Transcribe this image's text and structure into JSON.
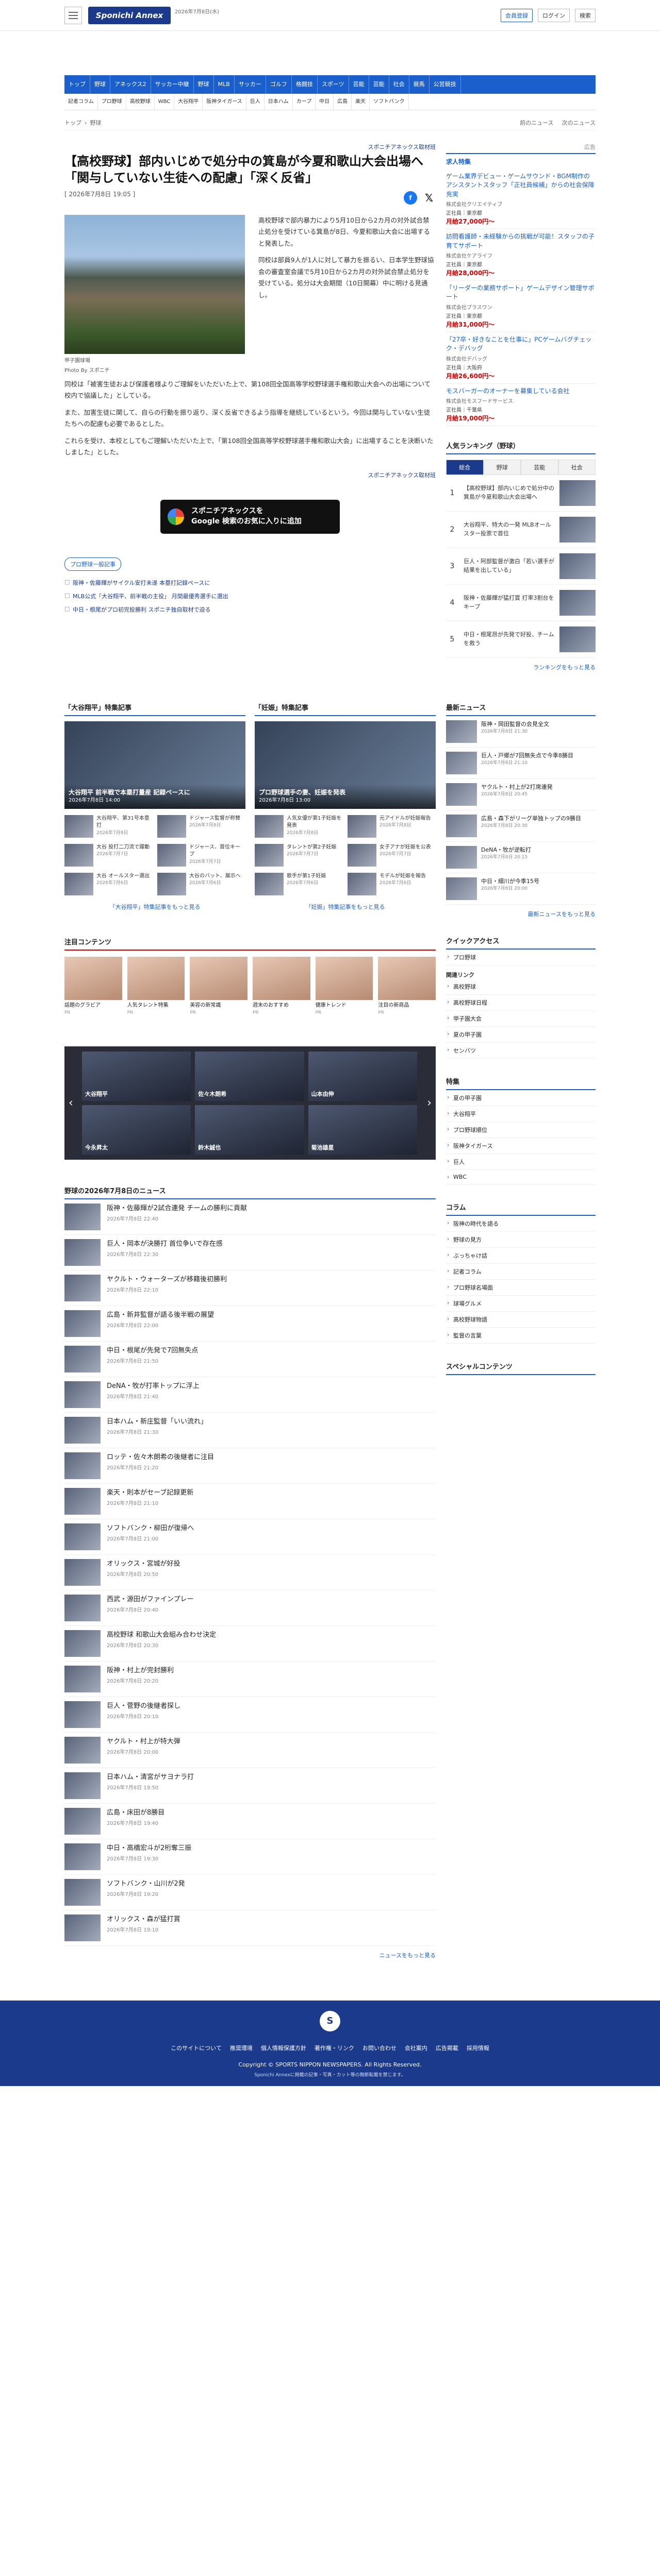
{
  "header": {
    "logo": "Sponichi Annex",
    "date": "2026年7月8日(水)",
    "login_btn": "会員登録",
    "login": "ログイン",
    "search": "検索"
  },
  "nav1": [
    "トップ",
    "野球",
    "アネックス2",
    "サッカー中継",
    "野球",
    "MLB",
    "サッカー",
    "ゴルフ",
    "格闘技",
    "スポーツ",
    "芸能",
    "芸能",
    "社会",
    "競馬",
    "公営競技"
  ],
  "nav2": [
    "記者コラム",
    "プロ野球",
    "高校野球",
    "WBC",
    "大谷翔平",
    "阪神タイガース",
    "巨人",
    "日本ハム",
    "カープ",
    "中日",
    "広島",
    "楽天",
    "ソフトバンク"
  ],
  "crumbs": {
    "top": "トップ",
    "cat": "野球",
    "prev": "前のニュース",
    "next": "次のニュース"
  },
  "article": {
    "source": "スポニチアネックス取材班",
    "title": "【高校野球】部内いじめで処分中の箕島が今夏和歌山大会出場へ「関与していない生徒への配慮」「深く反省」",
    "date": "[ 2026年7月8日 19:05 ]",
    "photo_cap1": "甲子園球場",
    "photo_cap2": "Photo By スポニチ",
    "p1": "高校野球で部内暴力により5月10日から2カ月の対外試合禁止処分を受けている箕島が8日、今夏和歌山大会に出場すると発表した。",
    "p2": "同校は部員9人が1人に対して暴力を振るい、日本学生野球協会の審査室会議で5月10日から2カ月の対外試合禁止処分を受けている。処分は大会期間（10日開幕）中に明ける見通し。",
    "p3": "同校は「被害生徒および保護者様よりご理解をいただいた上で、第108回全国高等学校野球選手権和歌山大会への出場について校内で協議した」としている。",
    "p4": "また、加害生徒に関して、自らの行動を振り返り、深く反省できるよう指導を継続しているという。今回は関与していない生徒たちへの配慮も必要であるとした。",
    "p5": "これらを受け、本校としてもご理解いただいた上で、「第108回全国高等学校野球選手権和歌山大会」に出場することを決断いたしました」とした。",
    "credit": "スポニチアネックス取材班",
    "gnews": "スポニチアネックスを\nGoogle 検索のお気に入りに追加",
    "tag": "プロ野球一般記事",
    "related": [
      "阪神・佐藤輝がサイクル安打未遂 本塁打記録ペースに",
      "MLB公式「大谷翔平、前半戦の主役」 月間最優秀選手に選出",
      "中日・根尾がプロ初完投勝利 スポニチ独自取材で迫る"
    ]
  },
  "side": {
    "ad_label": "広告",
    "pr_head": "求人特集",
    "pr": [
      {
        "t": "ゲーム業界デビュー・ゲームサウンド・BGM制作のアシスタントスタッフ「正社員候補」からの社会保障充実",
        "s": "株式会社クリエイティブ",
        "m": "正社員｜東京都",
        "y": "月給27,000円〜"
      },
      {
        "t": "訪問看護師・未経験からの挑戦が可能！スタッフの子育てサポート",
        "s": "株式会社ケアライフ",
        "m": "正社員｜東京都",
        "y": "月給28,000円〜"
      },
      {
        "t": "「リーダーの業務サポート」ゲームデザイン管理サポート",
        "s": "株式会社プラスワン",
        "m": "正社員｜東京都",
        "y": "月給31,000円〜"
      },
      {
        "t": "「27卒・好きなことを仕事に」PCゲームバグチェック・デバッグ",
        "s": "株式会社デバッグ",
        "m": "正社員｜大阪府",
        "y": "月給26,600円〜"
      },
      {
        "t": "モスバーガーのオーナーを募集している会社",
        "s": "株式会社モスフードサービス",
        "m": "正社員｜千葉県",
        "y": "月給19,000円〜"
      }
    ],
    "rank_head": "人気ランキング（野球）",
    "rank_tabs": [
      "総合",
      "野球",
      "芸能",
      "社会"
    ],
    "ranks": [
      {
        "n": "1",
        "t": "【高校野球】部内いじめで処分中の箕島が今夏和歌山大会出場へ"
      },
      {
        "n": "2",
        "t": "大谷翔平、特大の一発 MLBオールスター投票で首位"
      },
      {
        "n": "3",
        "t": "巨人・阿部監督が激白「若い選手が結果を出している」"
      },
      {
        "n": "4",
        "t": "阪神・佐藤輝が猛打賞 打率3割台をキープ"
      },
      {
        "n": "5",
        "t": "中日・根尾昂が先発で好投、チームを救う"
      }
    ],
    "rank_more": "ランキングをもっと見る",
    "news_head": "最新ニュース",
    "news": [
      {
        "t": "阪神・岡田監督の会見全文",
        "d": "2026年7月8日 21:30"
      },
      {
        "t": "巨人・戸郷が7回無失点で今季8勝目",
        "d": "2026年7月8日 21:10"
      },
      {
        "t": "ヤクルト・村上が2打席連発",
        "d": "2026年7月8日 20:45"
      },
      {
        "t": "広島・森下がリーグ単独トップの9勝目",
        "d": "2026年7月8日 20:30"
      },
      {
        "t": "DeNA・牧が逆転打",
        "d": "2026年7月8日 20:15"
      },
      {
        "t": "中日・細川が今季15号",
        "d": "2026年7月8日 20:00"
      }
    ],
    "news_more": "最新ニュースをもっと見る",
    "qa_head": "クイックアクセス",
    "qa": [
      "プロ野球"
    ],
    "qa_sub": "関連リンク",
    "qa2": [
      "高校野球",
      "高校野球日程",
      "甲子園大会",
      "夏の甲子園",
      "センバツ"
    ],
    "sp_head": "特集",
    "sp": [
      "夏の甲子園",
      "大谷翔平",
      "プロ野球順位",
      "阪神タイガース",
      "巨人",
      "WBC"
    ],
    "col_head": "コラム",
    "col": [
      "阪神の時代を語る",
      "野球の見方",
      "ぶっちゃけ話",
      "記者コラム",
      "プロ野球名場面",
      "球場グルメ",
      "高校野球物語",
      "監督の言葉"
    ],
    "sp2_head": "スペシャルコンテンツ"
  },
  "feat": [
    {
      "h": "「大谷翔平」特集記事",
      "big": "大谷翔平 前半戦で本塁打量産 記録ペースに",
      "bigd": "2026年7月8日 14:00",
      "items": [
        {
          "t": "大谷翔平、第31号本塁打",
          "d": "2026年7月8日"
        },
        {
          "t": "ドジャース監督が称賛",
          "d": "2026年7月8日"
        },
        {
          "t": "大谷 投打二刀流で躍動",
          "d": "2026年7月7日"
        },
        {
          "t": "ドジャース、首位キープ",
          "d": "2026年7月7日"
        },
        {
          "t": "大谷 オールスター選出",
          "d": "2026年7月6日"
        },
        {
          "t": "大谷のバット、展示へ",
          "d": "2026年7月6日"
        }
      ],
      "more": "「大谷翔平」特集記事をもっと見る"
    },
    {
      "h": "「妊娠」特集記事",
      "big": "プロ野球選手の妻、妊娠を発表",
      "bigd": "2026年7月8日 13:00",
      "items": [
        {
          "t": "人気女優が第1子妊娠を発表",
          "d": "2026年7月8日"
        },
        {
          "t": "元アイドルが妊娠報告",
          "d": "2026年7月8日"
        },
        {
          "t": "タレントが第2子妊娠",
          "d": "2026年7月7日"
        },
        {
          "t": "女子アナが妊娠を公表",
          "d": "2026年7月7日"
        },
        {
          "t": "歌手が第1子妊娠",
          "d": "2026年7月6日"
        },
        {
          "t": "モデルが妊娠を報告",
          "d": "2026年7月6日"
        }
      ],
      "more": "「妊娠」特集記事をもっと見る"
    }
  ],
  "attn": {
    "h": "注目コンテンツ",
    "items": [
      {
        "t": "話題のグラビア",
        "s": "PR"
      },
      {
        "t": "人気タレント特集",
        "s": "PR"
      },
      {
        "t": "美容の新常識",
        "s": "PR"
      },
      {
        "t": "週末のおすすめ",
        "s": "PR"
      },
      {
        "t": "健康トレンド",
        "s": "PR"
      },
      {
        "t": "注目の新商品",
        "s": "PR"
      }
    ]
  },
  "banner": [
    "大谷翔平",
    "佐々木朗希",
    "山本由伸",
    "今永昇太",
    "鈴木誠也",
    "菊池雄星"
  ],
  "list_head": "野球の2026年7月8日のニュース",
  "list": [
    {
      "t": "阪神・佐藤輝が2試合連発 チームの勝利に貢献",
      "d": "2026年7月8日 22:40"
    },
    {
      "t": "巨人・岡本が決勝打 首位争いで存在感",
      "d": "2026年7月8日 22:30"
    },
    {
      "t": "ヤクルト・ウォーターズが移籍後初勝利",
      "d": "2026年7月8日 22:10"
    },
    {
      "t": "広島・新井監督が語る後半戦の展望",
      "d": "2026年7月8日 22:00"
    },
    {
      "t": "中日・根尾が先発で7回無失点",
      "d": "2026年7月8日 21:50"
    },
    {
      "t": "DeNA・牧が打率トップに浮上",
      "d": "2026年7月8日 21:40"
    },
    {
      "t": "日本ハム・新庄監督「いい流れ」",
      "d": "2026年7月8日 21:30"
    },
    {
      "t": "ロッテ・佐々木朗希の後継者に注目",
      "d": "2026年7月8日 21:20"
    },
    {
      "t": "楽天・則本がセーブ記録更新",
      "d": "2026年7月8日 21:10"
    },
    {
      "t": "ソフトバンク・柳田が復帰へ",
      "d": "2026年7月8日 21:00"
    },
    {
      "t": "オリックス・宮城が好投",
      "d": "2026年7月8日 20:50"
    },
    {
      "t": "西武・源田がファインプレー",
      "d": "2026年7月8日 20:40"
    },
    {
      "t": "高校野球 和歌山大会組み合わせ決定",
      "d": "2026年7月8日 20:30"
    },
    {
      "t": "阪神・村上が完封勝利",
      "d": "2026年7月8日 20:20"
    },
    {
      "t": "巨人・菅野の後継者探し",
      "d": "2026年7月8日 20:10"
    },
    {
      "t": "ヤクルト・村上が特大弾",
      "d": "2026年7月8日 20:00"
    },
    {
      "t": "日本ハム・清宮がサヨナラ打",
      "d": "2026年7月8日 19:50"
    },
    {
      "t": "広島・床田が8勝目",
      "d": "2026年7月8日 19:40"
    },
    {
      "t": "中日・高橋宏斗が2桁奪三振",
      "d": "2026年7月8日 19:30"
    },
    {
      "t": "ソフトバンク・山川が2発",
      "d": "2026年7月8日 19:20"
    },
    {
      "t": "オリックス・森が猛打賞",
      "d": "2026年7月8日 19:10"
    }
  ],
  "list_more": "ニュースをもっと見る",
  "footer": {
    "logo": "S",
    "links": [
      "このサイトについて",
      "推奨環境",
      "個人情報保護方針",
      "著作権・リンク",
      "お問い合わせ",
      "会社案内",
      "広告掲載",
      "採用情報"
    ],
    "copy": "Copyright © SPORTS NIPPON NEWSPAPERS. All Rights Reserved.",
    "note": "Sponichi Annexに掲載の記事・写真・カット等の無断転載を禁じます。"
  }
}
